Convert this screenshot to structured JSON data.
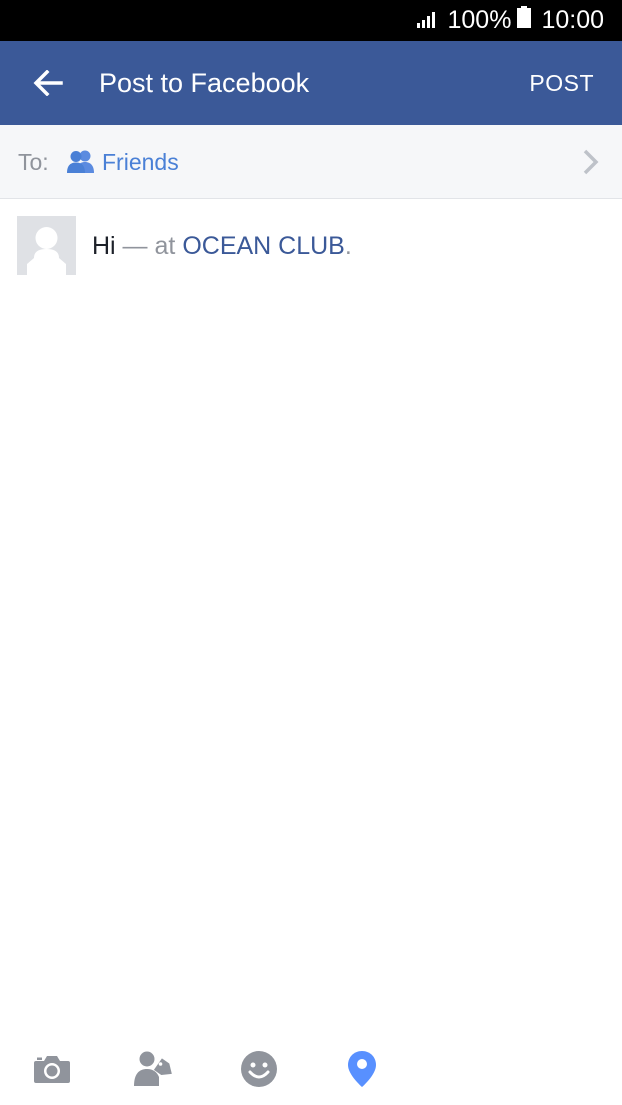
{
  "status_bar": {
    "battery_percent": "100%",
    "time": "10:00"
  },
  "app_bar": {
    "title": "Post to Facebook",
    "post_label": "POST",
    "back_icon": "arrow-left-icon",
    "background": "#3b5998"
  },
  "audience": {
    "to_label": "To:",
    "audience_icon": "friends-icon",
    "audience_value": "Friends",
    "chevron_icon": "chevron-right-icon"
  },
  "composer": {
    "message": "Hi",
    "separator": " — ",
    "at_label": "at ",
    "place": "OCEAN CLUB",
    "suffix": "."
  },
  "toolbar": {
    "items": [
      {
        "icon": "camera-icon",
        "active": false
      },
      {
        "icon": "tag-people-icon",
        "active": false
      },
      {
        "icon": "feeling-emoji-icon",
        "active": false
      },
      {
        "icon": "location-pin-icon",
        "active": true
      }
    ],
    "inactive_color": "#90949c",
    "active_color": "#5890ff"
  }
}
